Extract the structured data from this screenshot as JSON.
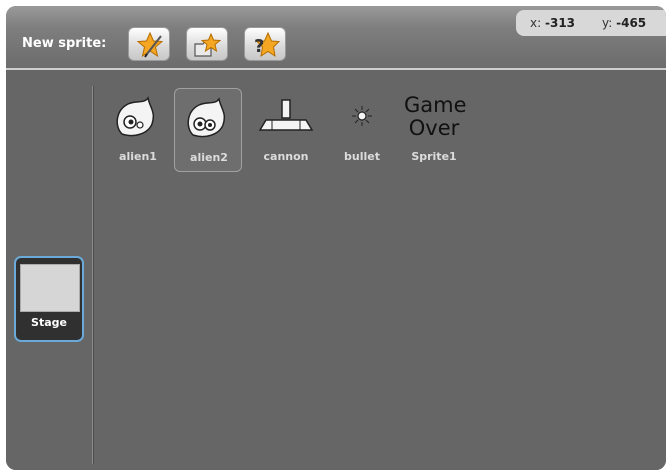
{
  "header": {
    "new_sprite_label": "New sprite:",
    "buttons": [
      {
        "icon": "paint-new-sprite-icon"
      },
      {
        "icon": "choose-sprite-from-file-icon"
      },
      {
        "icon": "surprise-sprite-icon"
      }
    ],
    "coords": {
      "x_label": "x:",
      "x_value": "-313",
      "y_label": "y:",
      "y_value": "-465"
    }
  },
  "stage": {
    "label": "Stage"
  },
  "sprites": [
    {
      "name": "alien1",
      "icon": "alien-icon"
    },
    {
      "name": "alien2",
      "icon": "alien-icon",
      "selected": true
    },
    {
      "name": "cannon",
      "icon": "cannon-icon"
    },
    {
      "name": "bullet",
      "icon": "bullet-icon"
    },
    {
      "name": "Sprite1",
      "icon": "game-over-text",
      "text_line1": "Game",
      "text_line2": "Over"
    }
  ],
  "colors": {
    "panel": "#666666",
    "selection_border": "#6aa9d8",
    "star": "#f5a623"
  }
}
